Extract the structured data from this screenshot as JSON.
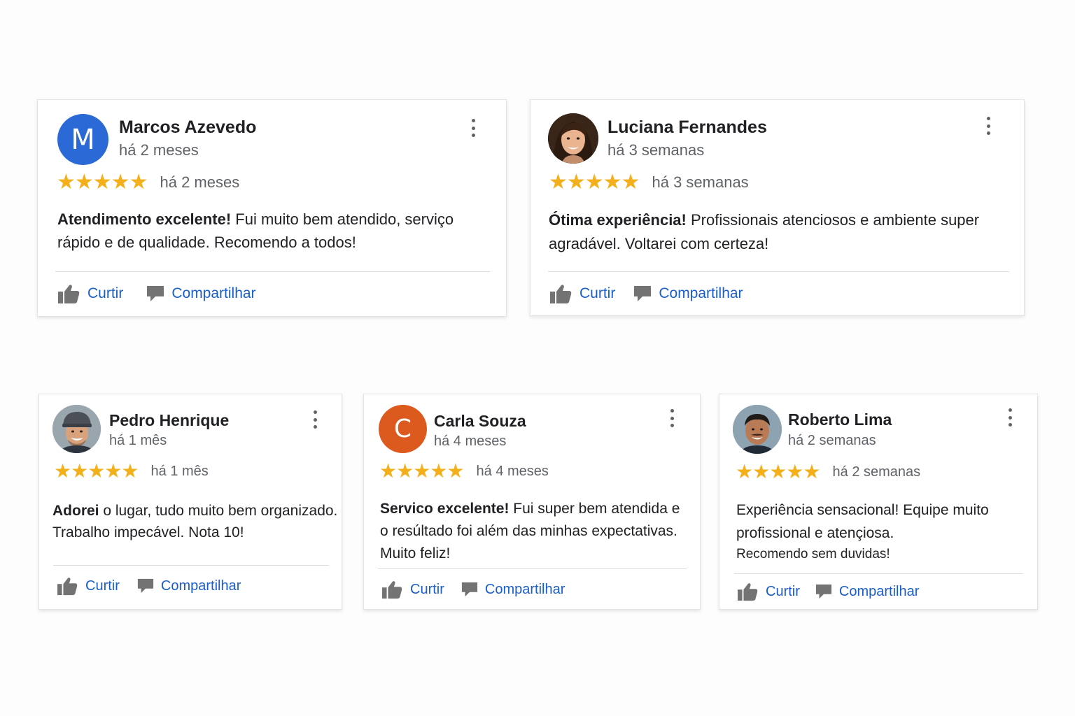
{
  "colors": {
    "star": "#f3b01a",
    "link": "#1a5fc9",
    "avatar_blue": "#2b6ad6",
    "avatar_orange": "#dd5a1e"
  },
  "icons": {
    "star": "star-icon",
    "like": "thumbs-up-icon",
    "share": "comment-icon",
    "menu": "more-vert-icon"
  },
  "reviews": [
    {
      "author": "Marcos Azevedo",
      "avatar_letter": "M",
      "avatar_kind": "letter",
      "subtitle": "há 2 meses",
      "rating": 5,
      "stars": "★★★★★",
      "date": "há 2 meses",
      "text_bold": "Atendimento excelente!",
      "text_rest": " Fui muito bem atendido, serviço rápido e de qualidade. Recomendo a todos!",
      "like_label": "Curtir",
      "share_label": "Compartilhar"
    },
    {
      "author": "Luciana Fernandes",
      "avatar_kind": "photo",
      "subtitle": "há 3 semanas",
      "rating": 5,
      "stars": "★★★★★",
      "date": "há 3 semanas",
      "text_bold": "Ótima experiência!",
      "text_rest": " Profissionais atenciosos e ambiente super agradável. Voltarei com certeza!",
      "like_label": "Curtir",
      "share_label": "Compartilhar"
    },
    {
      "author": "Pedro Henrique",
      "avatar_kind": "photo",
      "subtitle": "há 1 mês",
      "rating": 5,
      "stars": "★★★★★",
      "date": "há 1 mês",
      "text_bold": "Adorei",
      "text_rest": " o lugar, tudo muito bem organizado. Trabalho impecável. Nota 10!",
      "like_label": "Curtir",
      "share_label": "Compartilhar"
    },
    {
      "author": "Carla Souza",
      "avatar_letter": "C",
      "avatar_kind": "letter",
      "subtitle": "há 4 meses",
      "rating": 5,
      "stars": "★★★★★",
      "date": "há 4 meses",
      "text_bold": "Servico excelente!",
      "text_rest": " Fui super bem atendida e o resúltado foi além das minhas expectativas. Muito feliz!",
      "like_label": "Curtir",
      "share_label": "Compartilhar"
    },
    {
      "author": "Roberto Lima",
      "avatar_kind": "photo",
      "subtitle": "há 2 semanas",
      "rating": 5,
      "stars": "★★★★★",
      "date": "há 2 semanas",
      "text_bold": "",
      "text_rest": "Experiência sensacional! Equipe muito profissional e atençiosa.",
      "text_extra": "Recomendo sem duvidas!",
      "like_label": "Curtir",
      "share_label": "Compartilhar"
    }
  ]
}
